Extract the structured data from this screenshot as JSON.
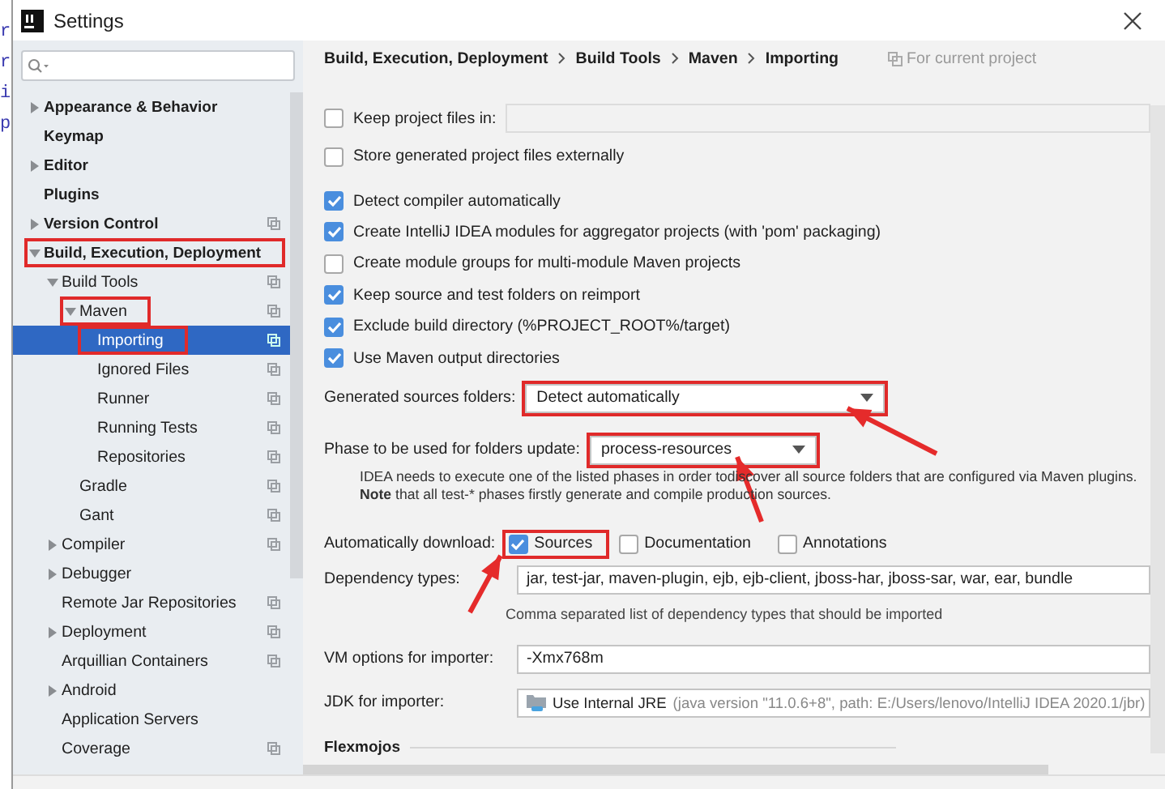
{
  "window": {
    "title": "Settings"
  },
  "background_code": [
    "r",
    "r",
    "i",
    "p"
  ],
  "sidebar": {
    "items": [
      {
        "label": "Appearance & Behavior",
        "expanded": false,
        "selected": false,
        "highlighted": false,
        "project_icon": false
      },
      {
        "label": "Keymap",
        "selected": false,
        "highlighted": false,
        "project_icon": false
      },
      {
        "label": "Editor",
        "expanded": false,
        "selected": false,
        "highlighted": false,
        "project_icon": false
      },
      {
        "label": "Plugins",
        "selected": false,
        "highlighted": false,
        "project_icon": false
      },
      {
        "label": "Version Control",
        "expanded": false,
        "selected": false,
        "highlighted": false,
        "project_icon": true
      },
      {
        "label": "Build, Execution, Deployment",
        "expanded": true,
        "selected": false,
        "highlighted": true,
        "project_icon": false,
        "children": [
          {
            "label": "Build Tools",
            "expanded": true,
            "selected": false,
            "highlighted": false,
            "project_icon": true,
            "children": [
              {
                "label": "Maven",
                "expanded": true,
                "selected": false,
                "highlighted": true,
                "project_icon": true,
                "children": [
                  {
                    "label": "Importing",
                    "selected": true,
                    "highlighted": true,
                    "project_icon": true
                  },
                  {
                    "label": "Ignored Files",
                    "selected": false,
                    "highlighted": false,
                    "project_icon": true
                  },
                  {
                    "label": "Runner",
                    "selected": false,
                    "highlighted": false,
                    "project_icon": true
                  },
                  {
                    "label": "Running Tests",
                    "selected": false,
                    "highlighted": false,
                    "project_icon": true
                  },
                  {
                    "label": "Repositories",
                    "selected": false,
                    "highlighted": false,
                    "project_icon": true
                  }
                ]
              },
              {
                "label": "Gradle",
                "selected": false,
                "highlighted": false,
                "project_icon": true
              },
              {
                "label": "Gant",
                "selected": false,
                "highlighted": false,
                "project_icon": true
              }
            ]
          },
          {
            "label": "Compiler",
            "expanded": false,
            "selected": false,
            "highlighted": false,
            "project_icon": true
          },
          {
            "label": "Debugger",
            "expanded": false,
            "selected": false,
            "highlighted": false,
            "project_icon": false
          },
          {
            "label": "Remote Jar Repositories",
            "selected": false,
            "highlighted": false,
            "project_icon": true
          },
          {
            "label": "Deployment",
            "expanded": false,
            "selected": false,
            "highlighted": false,
            "project_icon": true
          },
          {
            "label": "Arquillian Containers",
            "selected": false,
            "highlighted": false,
            "project_icon": true
          },
          {
            "label": "Android",
            "expanded": false,
            "selected": false,
            "highlighted": false,
            "project_icon": false
          },
          {
            "label": "Application Servers",
            "selected": false,
            "highlighted": false,
            "project_icon": false
          },
          {
            "label": "Coverage",
            "selected": false,
            "highlighted": false,
            "project_icon": true
          }
        ]
      }
    ]
  },
  "breadcrumb": {
    "items": [
      "Build, Execution, Deployment",
      "Build Tools",
      "Maven",
      "Importing"
    ],
    "scope": "For current project"
  },
  "keep_project_files": {
    "label": "Keep project files in:",
    "checked": false
  },
  "storage_options": [
    {
      "label": "Store generated project files externally",
      "checked": false
    }
  ],
  "detection_options": [
    {
      "label": "Detect compiler automatically",
      "checked": true
    },
    {
      "label": "Create IntelliJ IDEA modules for aggregator projects (with 'pom' packaging)",
      "checked": true
    },
    {
      "label": "Create module groups for multi-module Maven projects",
      "checked": false
    },
    {
      "label": "Keep source and test folders on reimport",
      "checked": true
    },
    {
      "label": "Exclude build directory (%PROJECT_ROOT%/target)",
      "checked": true
    },
    {
      "label": "Use Maven output directories",
      "checked": true
    }
  ],
  "generated_sources": {
    "label": "Generated sources folders:",
    "value": "Detect automatically",
    "highlighted": true
  },
  "phase": {
    "label": "Phase to be used for folders update:",
    "value": "process-resources",
    "highlighted": true,
    "note_lines": [
      "IDEA needs to execute one of the listed phases in order todiscover all source folders that are configured via Maven plugins.",
      "**Note** that all test-* phases firstly generate and compile production sources."
    ]
  },
  "auto_download": {
    "label": "Automatically download:",
    "options": [
      {
        "label": "Sources",
        "checked": true,
        "highlighted": true
      },
      {
        "label": "Documentation",
        "checked": false,
        "highlighted": false
      },
      {
        "label": "Annotations",
        "checked": false,
        "highlighted": false
      }
    ]
  },
  "dependency_types": {
    "label": "Dependency types:",
    "value": "jar, test-jar, maven-plugin, ejb, ejb-client, jboss-har, jboss-sar, war, ear, bundle",
    "hint": "Comma separated list of dependency types that should be imported"
  },
  "vm_options": {
    "label": "VM options for importer:",
    "value": "-Xmx768m"
  },
  "jdk": {
    "label": "JDK for importer:",
    "value": "Use Internal JRE",
    "detail": "(java version \"11.0.6+8\", path: E:/Users/lenovo/IntelliJ IDEA 2020.1/jbr)"
  },
  "section": {
    "title": "Flexmojos"
  }
}
